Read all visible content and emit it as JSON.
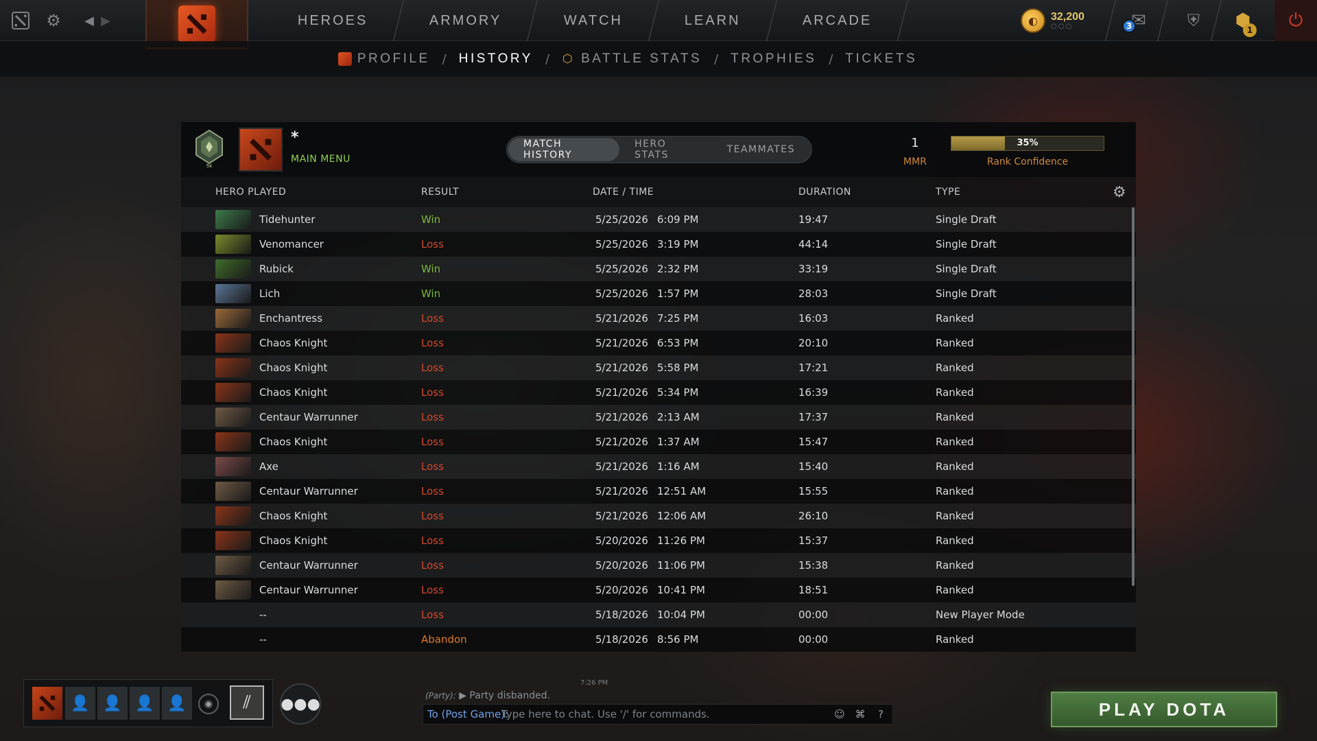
{
  "topbar": {
    "nav": [
      "HEROES",
      "ARMORY",
      "WATCH",
      "LEARN",
      "ARCADE"
    ],
    "gold": "32,200",
    "gold_dots": "○○○",
    "mail_badge": "3",
    "plus_badge": "1"
  },
  "subnav": {
    "items": [
      "PROFILE",
      "HISTORY",
      "BATTLE STATS",
      "TROPHIES",
      "TICKETS"
    ],
    "separator": "/",
    "active": "HISTORY"
  },
  "header": {
    "medal_label": "5k",
    "user_name": "*",
    "user_status": "MAIN MENU",
    "tabs": [
      "MATCH HISTORY",
      "HERO STATS",
      "TEAMMATES"
    ],
    "mmr_value": "1",
    "mmr_label": "MMR",
    "rank_confidence_percent": "35%",
    "rank_confidence_value": 0.35,
    "rank_confidence_label": "Rank Confidence"
  },
  "table": {
    "headers": {
      "hero": "HERO PLAYED",
      "result": "RESULT",
      "datetime": "DATE / TIME",
      "duration": "DURATION",
      "type": "TYPE"
    },
    "rows": [
      {
        "hero": "Tidehunter",
        "result": "Win",
        "date": "5/25/2026",
        "time": "6:09 PM",
        "duration": "19:47",
        "type": "Single Draft",
        "color": "#3c7a4a"
      },
      {
        "hero": "Venomancer",
        "result": "Loss",
        "date": "5/25/2026",
        "time": "3:19 PM",
        "duration": "44:14",
        "type": "Single Draft",
        "color": "#7a8a2a"
      },
      {
        "hero": "Rubick",
        "result": "Win",
        "date": "5/25/2026",
        "time": "2:32 PM",
        "duration": "33:19",
        "type": "Single Draft",
        "color": "#3f6b2a"
      },
      {
        "hero": "Lich",
        "result": "Win",
        "date": "5/25/2026",
        "time": "1:57 PM",
        "duration": "28:03",
        "type": "Single Draft",
        "color": "#5a7596"
      },
      {
        "hero": "Enchantress",
        "result": "Loss",
        "date": "5/21/2026",
        "time": "7:25 PM",
        "duration": "16:03",
        "type": "Ranked",
        "color": "#9a6a3a"
      },
      {
        "hero": "Chaos Knight",
        "result": "Loss",
        "date": "5/21/2026",
        "time": "6:53 PM",
        "duration": "20:10",
        "type": "Ranked",
        "color": "#8a3418"
      },
      {
        "hero": "Chaos Knight",
        "result": "Loss",
        "date": "5/21/2026",
        "time": "5:58 PM",
        "duration": "17:21",
        "type": "Ranked",
        "color": "#8a3418"
      },
      {
        "hero": "Chaos Knight",
        "result": "Loss",
        "date": "5/21/2026",
        "time": "5:34 PM",
        "duration": "16:39",
        "type": "Ranked",
        "color": "#8a3418"
      },
      {
        "hero": "Centaur Warrunner",
        "result": "Loss",
        "date": "5/21/2026",
        "time": "2:13 AM",
        "duration": "17:37",
        "type": "Ranked",
        "color": "#6e5a44"
      },
      {
        "hero": "Chaos Knight",
        "result": "Loss",
        "date": "5/21/2026",
        "time": "1:37 AM",
        "duration": "15:47",
        "type": "Ranked",
        "color": "#8a3418"
      },
      {
        "hero": "Axe",
        "result": "Loss",
        "date": "5/21/2026",
        "time": "1:16 AM",
        "duration": "15:40",
        "type": "Ranked",
        "color": "#7a4a48"
      },
      {
        "hero": "Centaur Warrunner",
        "result": "Loss",
        "date": "5/21/2026",
        "time": "12:51 AM",
        "duration": "15:55",
        "type": "Ranked",
        "color": "#6e5a44"
      },
      {
        "hero": "Chaos Knight",
        "result": "Loss",
        "date": "5/21/2026",
        "time": "12:06 AM",
        "duration": "26:10",
        "type": "Ranked",
        "color": "#8a3418"
      },
      {
        "hero": "Chaos Knight",
        "result": "Loss",
        "date": "5/20/2026",
        "time": "11:26 PM",
        "duration": "15:37",
        "type": "Ranked",
        "color": "#8a3418"
      },
      {
        "hero": "Centaur Warrunner",
        "result": "Loss",
        "date": "5/20/2026",
        "time": "11:06 PM",
        "duration": "15:38",
        "type": "Ranked",
        "color": "#6e5a44"
      },
      {
        "hero": "Centaur Warrunner",
        "result": "Loss",
        "date": "5/20/2026",
        "time": "10:41 PM",
        "duration": "18:51",
        "type": "Ranked",
        "color": "#6e5a44"
      },
      {
        "hero": "--",
        "result": "Loss",
        "date": "5/18/2026",
        "time": "10:04 PM",
        "duration": "00:00",
        "type": "New Player Mode",
        "color": ""
      },
      {
        "hero": "--",
        "result": "Abandon",
        "date": "5/18/2026",
        "time": "8:56 PM",
        "duration": "00:00",
        "type": "Ranked",
        "color": ""
      }
    ]
  },
  "chat": {
    "timestamp": "7:26 PM",
    "party_tag": "(Party):",
    "message": "Party disbanded.",
    "target": "To (Post Game):",
    "placeholder": "Type here to chat. Use '/' for commands."
  },
  "play_button": "PLAY DOTA",
  "colors": {
    "win": "#79b83a",
    "loss": "#d2492d",
    "abandon": "#e07a22",
    "accent_orange": "#cf8a3a",
    "play_green": "#4f7d43"
  }
}
